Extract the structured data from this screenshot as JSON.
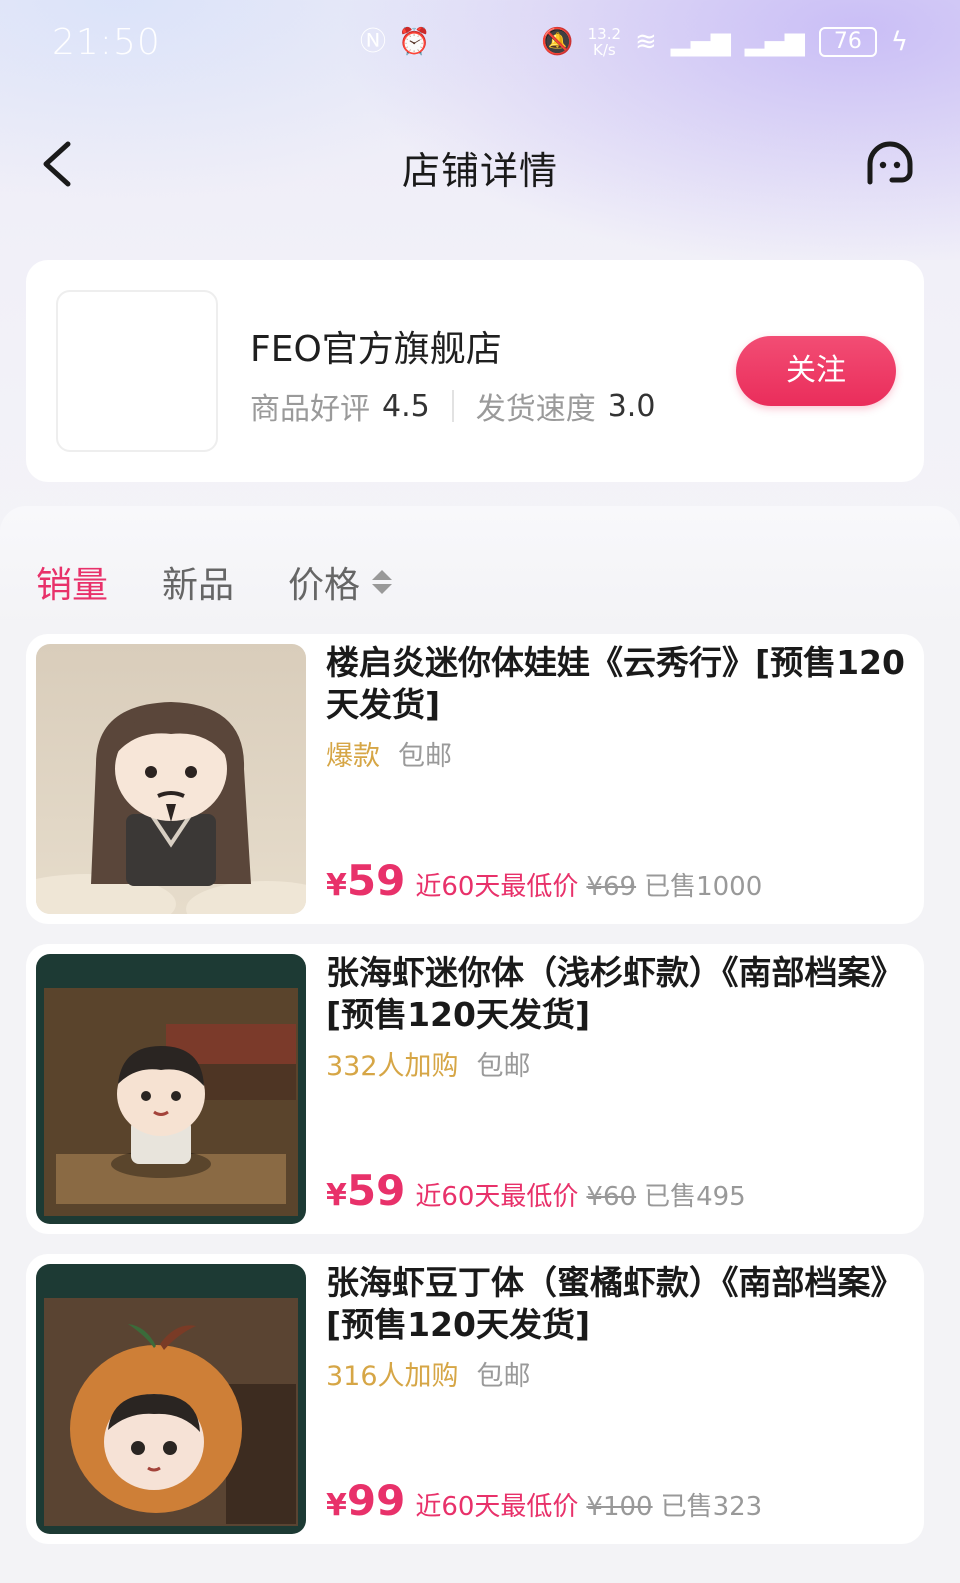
{
  "status_bar": {
    "time": "21:50",
    "net_speed": "13.2",
    "net_unit": "K/s",
    "battery": "76"
  },
  "header": {
    "title": "店铺详情"
  },
  "shop": {
    "name": "FEO官方旗舰店",
    "rating_label": "商品好评",
    "rating_value": "4.5",
    "shipping_label": "发货速度",
    "shipping_value": "3.0",
    "follow_label": "关注"
  },
  "sort_tabs": [
    {
      "label": "销量",
      "active": true
    },
    {
      "label": "新品",
      "active": false
    },
    {
      "label": "价格",
      "active": false
    }
  ],
  "products": [
    {
      "title": "楼启炎迷你体娃娃《云秀行》[预售120天发货]",
      "tag": "爆款",
      "shipping": "包邮",
      "currency": "¥",
      "price": "59",
      "low_label": "近60天最低价",
      "original_price": "¥69",
      "sold": "已售1000"
    },
    {
      "title": "张海虾迷你体（浅杉虾款）《南部档案》[预售120天发货]",
      "tag": "332人加购",
      "shipping": "包邮",
      "currency": "¥",
      "price": "59",
      "low_label": "近60天最低价",
      "original_price": "¥60",
      "sold": "已售495"
    },
    {
      "title": "张海虾豆丁体（蜜橘虾款）《南部档案》[预售120天发货]",
      "tag": "316人加购",
      "shipping": "包邮",
      "currency": "¥",
      "price": "99",
      "low_label": "近60天最低价",
      "original_price": "¥100",
      "sold": "已售323"
    }
  ],
  "colors": {
    "accent": "#e8316a",
    "tag_gold": "#d6a646",
    "muted": "#9a9a9a"
  }
}
